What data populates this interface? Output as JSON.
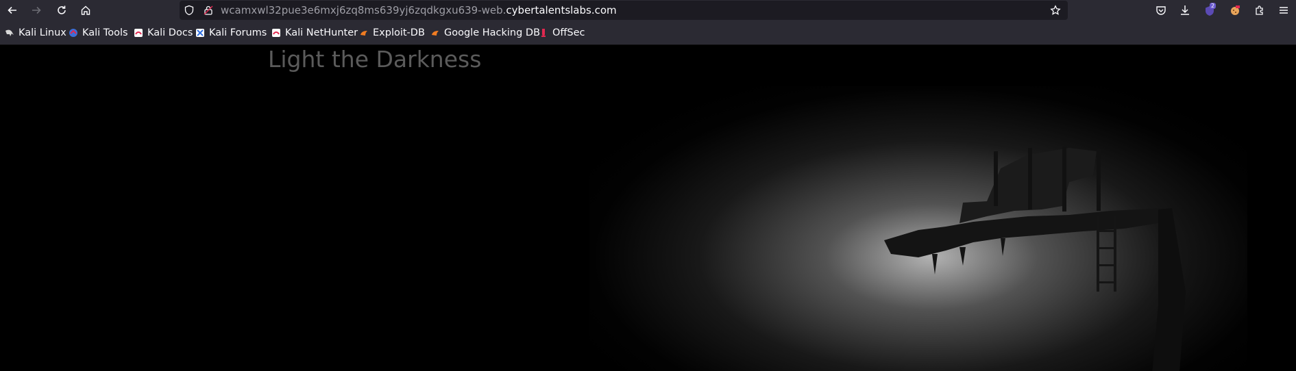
{
  "toolbar": {
    "back_icon": "arrow-left-icon",
    "forward_icon": "arrow-right-icon",
    "reload_icon": "reload-icon",
    "home_icon": "home-icon"
  },
  "urlbar": {
    "url_prefix": "wcamxwl32pue3e6mxj6zq8ms639yj6zqdkgxu639-web.",
    "url_domain": "cybertalentslabs.com"
  },
  "extensions": {
    "badge_count": "2"
  },
  "bookmarks": [
    {
      "label": "Kali Linux",
      "icon": "kali-dragon-icon"
    },
    {
      "label": "Kali Tools",
      "icon": "kali-tools-icon"
    },
    {
      "label": "Kali Docs",
      "icon": "kali-docs-icon"
    },
    {
      "label": "Kali Forums",
      "icon": "kali-forums-icon"
    },
    {
      "label": "Kali NetHunter",
      "icon": "kali-nethunter-icon"
    },
    {
      "label": "Exploit-DB",
      "icon": "exploit-db-icon"
    },
    {
      "label": "Google Hacking DB",
      "icon": "ghdb-icon"
    },
    {
      "label": "OffSec",
      "icon": "offsec-icon"
    }
  ],
  "page": {
    "title": "Light the Darkness"
  },
  "colors": {
    "chrome_bg": "#2b2a33",
    "urlbar_bg": "#1c1b22",
    "page_bg": "#000000",
    "title_color": "#5b5b5b"
  }
}
